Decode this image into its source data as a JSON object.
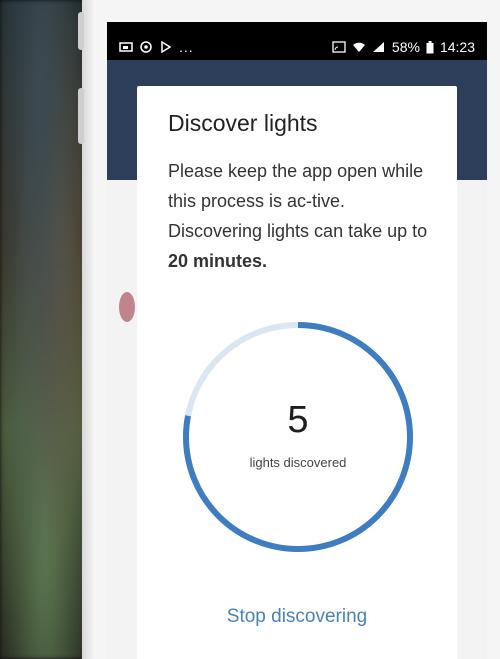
{
  "status_bar": {
    "battery": "58%",
    "time": "14:23",
    "left_icons": [
      "cast-screen-icon",
      "clock-icon",
      "play-icon"
    ],
    "right_icons": [
      "cast-icon",
      "wifi-icon",
      "signal-icon",
      "battery-icon"
    ],
    "overflow": "..."
  },
  "dialog": {
    "title": "Discover lights",
    "description_text": "Please keep the app open while this process is ac-tive. Discovering lights can take up to ",
    "description_bold": "20 minutes.",
    "progress": {
      "count": "5",
      "label": "lights discovered",
      "fraction": 0.78,
      "accent": "#3d7dc0",
      "track": "#dbe6f3"
    },
    "stop_button": "Stop discovering"
  }
}
